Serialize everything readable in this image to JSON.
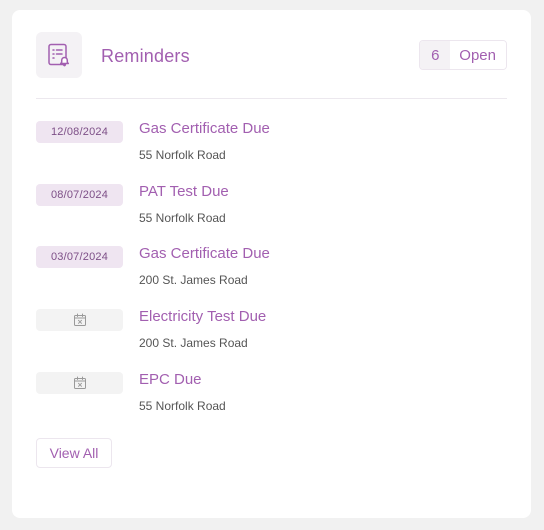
{
  "header": {
    "icon": "reminder-list-icon",
    "title": "Reminders",
    "count": "6",
    "count_label": "Open"
  },
  "reminders": [
    {
      "date": "12/08/2024",
      "title": "Gas Certificate Due",
      "address": "55 Norfolk Road"
    },
    {
      "date": "08/07/2024",
      "title": "PAT Test Due",
      "address": "55 Norfolk Road"
    },
    {
      "date": "03/07/2024",
      "title": "Gas Certificate Due",
      "address": "200 St. James Road"
    },
    {
      "date": null,
      "date_icon": "calendar-x-icon",
      "title": "Electricity Test Due",
      "address": "200 St. James Road"
    },
    {
      "date": null,
      "date_icon": "calendar-x-icon",
      "title": "EPC Due",
      "address": "55 Norfolk Road"
    }
  ],
  "footer": {
    "view_all_label": "View All"
  },
  "colors": {
    "accent": "#a25fb0",
    "badge_bg": "#efe5f1",
    "badge_text": "#7d4f87",
    "empty_badge_bg": "#f3f3f3"
  }
}
